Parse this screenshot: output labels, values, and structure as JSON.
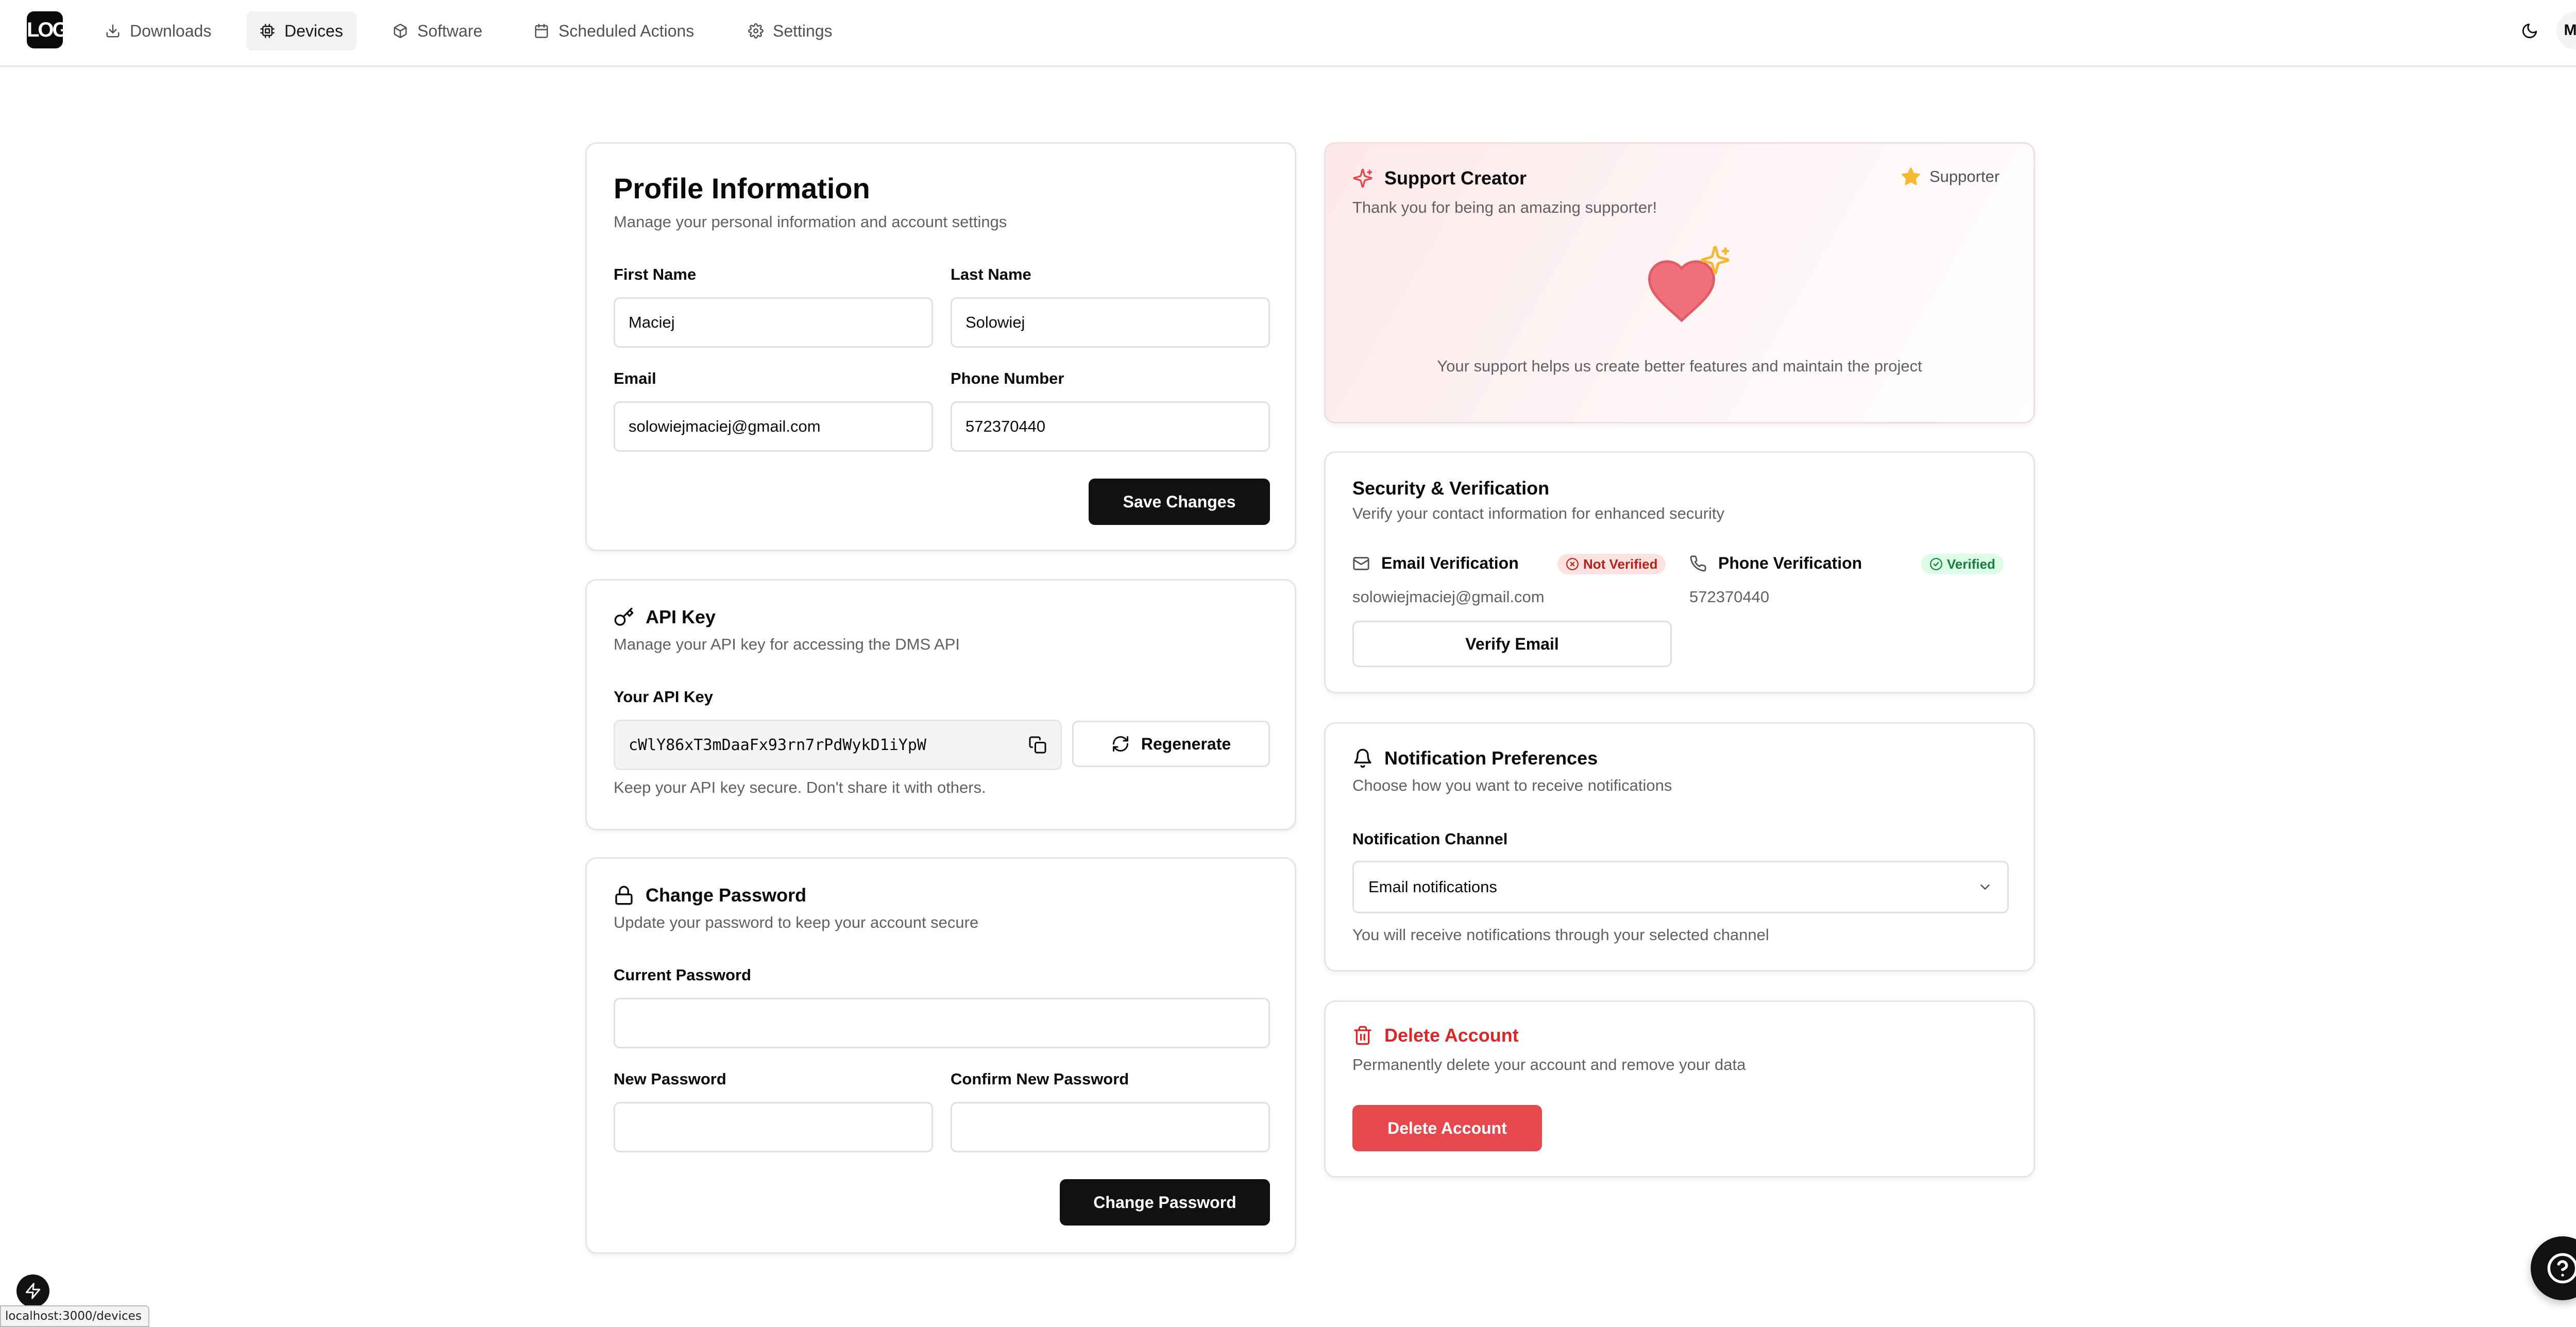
{
  "nav": {
    "logo_text": "LOGO",
    "items": [
      {
        "label": "Downloads",
        "icon": "download-icon"
      },
      {
        "label": "Devices",
        "icon": "cpu-icon",
        "active": true
      },
      {
        "label": "Software",
        "icon": "package-icon"
      },
      {
        "label": "Scheduled Actions",
        "icon": "calendar-icon"
      },
      {
        "label": "Settings",
        "icon": "gear-icon"
      }
    ],
    "avatar_initials": "MS"
  },
  "profile": {
    "title": "Profile Information",
    "description": "Manage your personal information and account settings",
    "first_name_label": "First Name",
    "first_name_value": "Maciej",
    "last_name_label": "Last Name",
    "last_name_value": "Solowiej",
    "email_label": "Email",
    "email_value": "solowiejmaciej@gmail.com",
    "phone_label": "Phone Number",
    "phone_value": "572370440",
    "save_label": "Save Changes"
  },
  "api_key": {
    "title": "API Key",
    "description": "Manage your API key for accessing the DMS API",
    "label": "Your API Key",
    "value": "cWlY86xT3mDaaFx93rn7rPdWykD1iYpW",
    "regenerate_label": "Regenerate",
    "hint": "Keep your API key secure. Don't share it with others."
  },
  "password": {
    "title": "Change Password",
    "description": "Update your password to keep your account secure",
    "current_label": "Current Password",
    "new_label": "New Password",
    "confirm_label": "Confirm New Password",
    "button_label": "Change Password"
  },
  "support": {
    "title": "Support Creator",
    "subtitle": "Thank you for being an amazing supporter!",
    "badge": "Supporter",
    "message": "Your support helps us create better features and maintain the project",
    "accent_color": "#f0707a",
    "star_color": "#f5b82e"
  },
  "security": {
    "title": "Security & Verification",
    "description": "Verify your contact information for enhanced security",
    "email_label": "Email Verification",
    "email_status": "Not Verified",
    "email_value": "solowiejmaciej@gmail.com",
    "verify_email_label": "Verify Email",
    "phone_label": "Phone Verification",
    "phone_status": "Verified",
    "phone_value": "572370440"
  },
  "notifications": {
    "title": "Notification Preferences",
    "description": "Choose how you want to receive notifications",
    "channel_label": "Notification Channel",
    "channel_value": "Email notifications",
    "hint": "You will receive notifications through your selected channel"
  },
  "delete": {
    "title": "Delete Account",
    "description": "Permanently delete your account and remove your data",
    "button_label": "Delete Account",
    "danger_color": "#e5484d"
  },
  "status_bar": {
    "url": "localhost:3000/devices"
  }
}
